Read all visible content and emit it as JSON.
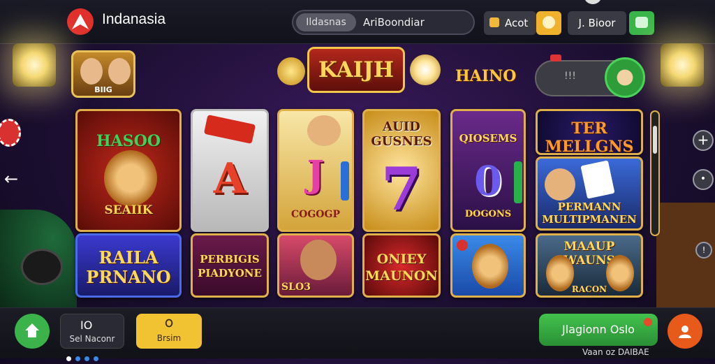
{
  "header": {
    "app_name": "Indanasia",
    "tabs": [
      "Ildasnas",
      "AriBoondiar"
    ],
    "account_label": "Acot",
    "balance_label": "J. Bioor"
  },
  "banner": {
    "brand": "KAIJH",
    "subtitle": "HAINO",
    "characters_label": "BIIG",
    "pill_text": "!!!"
  },
  "games": [
    {
      "title": "HASOO",
      "sub": "SEAIIK"
    },
    {
      "title": "A"
    },
    {
      "title": "J",
      "sub": "COGOGP"
    },
    {
      "title": "AUID GUSNES",
      "big": "7"
    },
    {
      "title": "QIOSEMS",
      "big": "0",
      "sub": "DOGONS"
    },
    {
      "title": "TER MELLGNS"
    },
    {
      "title": "PERMANN MULTIPMANEN"
    },
    {
      "title": "RAILA PRNANO"
    },
    {
      "title": "PERBIGIS PIADYONE"
    },
    {
      "title": "SLO3"
    },
    {
      "title": "ONIEY MAUNON"
    },
    {
      "title": ""
    },
    {
      "title": "MAAUP WAUNS",
      "sub": "RACON"
    }
  ],
  "footer": {
    "tab_label": "Sel Naconr",
    "tab_icon": "IO",
    "yellow_icon": "ଠ",
    "yellow_label": "Brsim",
    "green_button": "Jlagionn Oslo",
    "green_sub": "Vaan oz DAIBAE"
  },
  "colors": {
    "accent_gold": "#e0b04a",
    "green": "#3bb34a",
    "orange": "#e85a1a"
  }
}
